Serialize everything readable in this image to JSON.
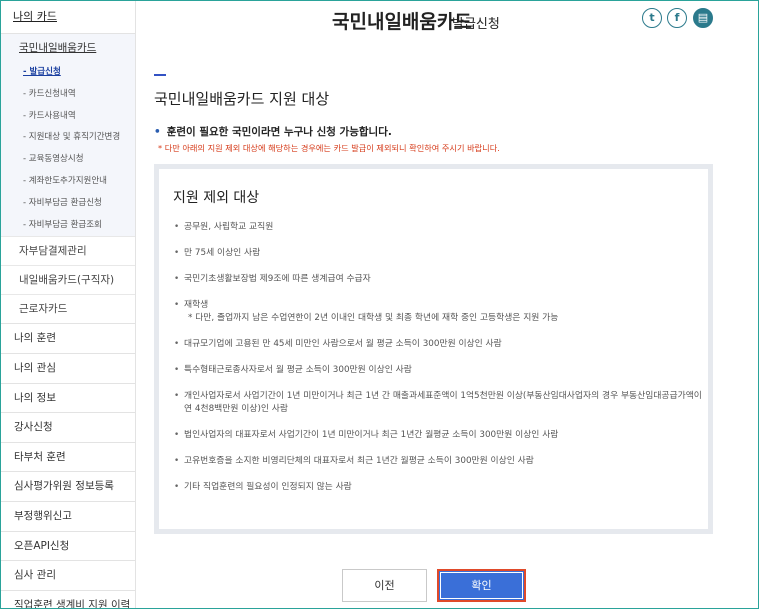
{
  "sidebar": {
    "header": "나의 카드",
    "group_title": "국민내일배움카드",
    "sub_items": [
      {
        "label": "- 발급신청",
        "active": true
      },
      {
        "label": "- 카드신청내역",
        "active": false
      },
      {
        "label": "- 카드사용내역",
        "active": false
      },
      {
        "label": "- 지원대상 및 휴직기간변경",
        "active": false
      },
      {
        "label": "- 교육동영상시청",
        "active": false
      },
      {
        "label": "- 계좌한도추가지원안내",
        "active": false
      },
      {
        "label": "- 자비부담금 환급신청",
        "active": false
      },
      {
        "label": "- 자비부담금 환급조회",
        "active": false
      }
    ],
    "sub_main_items": [
      "자부담결제관리",
      "내일배움카드(구직자)",
      "근로자카드"
    ],
    "items": [
      "나의 훈련",
      "나의 관심",
      "나의 정보",
      "강사신청",
      "타부처 훈련",
      "심사평가위원 정보등록",
      "부정행위신고",
      "오픈API신청",
      "심사 관리",
      "직업훈련 생계비 지원 이력"
    ]
  },
  "header": {
    "title": "국민내일배움카드",
    "subtitle": "발급신청",
    "share_icons": [
      "twitter-icon",
      "facebook-icon",
      "print-icon"
    ]
  },
  "main": {
    "section_title": "국민내일배움카드 지원 대상",
    "lead": "훈련이 필요한 국민이라면 누구나 신청 가능합니다.",
    "note": "* 다만 아래의 지원 제외 대상에 해당하는 경우에는 카드 발급이 제외되니 확인하여 주시기 바랍니다.",
    "exclusion_box": {
      "title": "지원 제외 대상",
      "items": [
        {
          "text": "공무원, 사립학교 교직원",
          "sub": ""
        },
        {
          "text": "만 75세 이상인 사람",
          "sub": ""
        },
        {
          "text": "국민기초생활보장법 제9조에 따른 생계급여 수급자",
          "sub": ""
        },
        {
          "text": "재학생",
          "sub": "* 다만, 졸업까지 남은 수업연한이 2년 이내인 대학생 및 최종 학년에 재학 중인 고등학생은 지원 가능"
        },
        {
          "text": "대규모기업에 고용된 만 45세 미만인 사람으로서 월 평균 소득이 300만원 이상인 사람",
          "sub": ""
        },
        {
          "text": "특수형태근로종사자로서 월 평균 소득이 300만원 이상인 사람",
          "sub": ""
        },
        {
          "text": "개인사업자로서 사업기간이 1년 미만이거나 최근 1년 간 매출과세표준액이 1억5천만원 이상(부동산임대사업자의 경우 부동산임대공급가액이 연 4천8백만원 이상)인 사람",
          "sub": ""
        },
        {
          "text": "법인사업자의 대표자로서 사업기간이 1년 미만이거나 최근 1년간 월평균 소득이 300만원 이상인 사람",
          "sub": ""
        },
        {
          "text": "고유번호증을 소지한 비영리단체의 대표자로서 최근 1년간 월평균 소득이 300만원 이상인 사람",
          "sub": ""
        },
        {
          "text": "기타 직업훈련의 필요성이 인정되지 않는 사람",
          "sub": ""
        }
      ]
    }
  },
  "buttons": {
    "prev": "이전",
    "confirm": "확인"
  },
  "colors": {
    "accent": "#3352c4",
    "confirm_button": "#3a6fd8",
    "highlight_border": "#e04a2a",
    "note_red": "#d63b1a",
    "frame": "#2aa39a"
  }
}
